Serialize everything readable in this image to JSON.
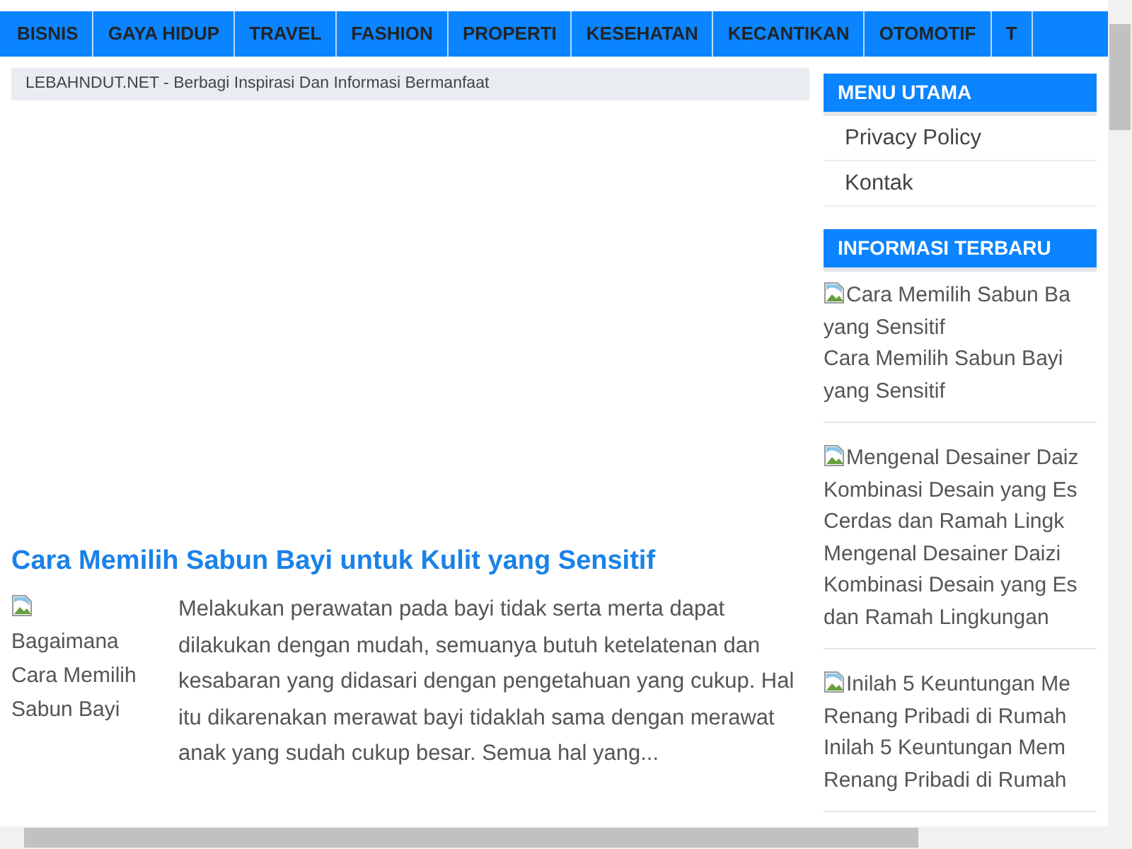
{
  "nav": {
    "items": [
      "BISNIS",
      "GAYA HIDUP",
      "TRAVEL",
      "FASHION",
      "PROPERTI",
      "KESEHATAN",
      "KECANTIKAN",
      "OTOMOTIF",
      "T"
    ]
  },
  "breadcrumb": "LEBAHNDUT.NET - Berbagi Inspirasi Dan Informasi Bermanfaat",
  "post": {
    "title": "Cara Memilih Sabun Bayi untuk Kulit yang Sensitif",
    "image_alt": "Bagaimana Cara Memilih Sabun Bayi",
    "excerpt": "Melakukan perawatan pada bayi tidak serta merta dapat dilakukan dengan mudah, semuanya butuh ketelatenan dan kesabaran yang didasari dengan pengetahuan yang cukup. Hal itu dikarenakan merawat bayi tidaklah sama dengan merawat anak yang sudah cukup besar. Semua hal yang..."
  },
  "sidebar": {
    "menu_title": "MENU UTAMA",
    "menu_items": [
      "Privacy Policy",
      "Kontak"
    ],
    "recent_title": "INFORMASI TERBARU",
    "recent_posts": [
      {
        "image_alt_lines": [
          "Cara Memilih Sabun Ba",
          "yang Sensitif"
        ],
        "title_lines": [
          "Cara Memilih Sabun Bayi",
          "yang Sensitif"
        ]
      },
      {
        "image_alt_lines": [
          "Mengenal Desainer Daiz",
          "Kombinasi Desain yang Es",
          "Cerdas dan Ramah Lingk"
        ],
        "title_lines": [
          "Mengenal Desainer Daizi",
          "Kombinasi Desain yang Es",
          "dan Ramah Lingkungan"
        ]
      },
      {
        "image_alt_lines": [
          "Inilah 5 Keuntungan Me",
          "Renang Pribadi di Rumah"
        ],
        "title_lines": [
          "Inilah 5 Keuntungan Mem",
          "Renang Pribadi di Rumah"
        ]
      }
    ]
  }
}
